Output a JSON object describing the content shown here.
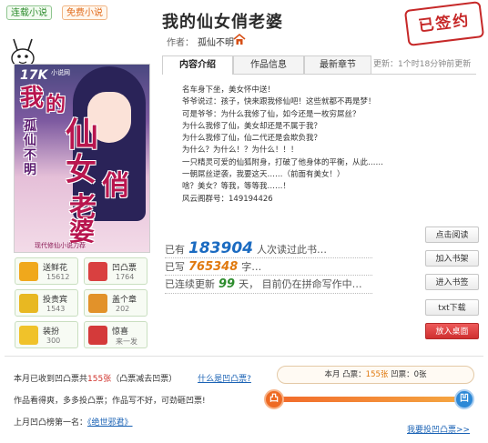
{
  "tags": {
    "serial": "连载小说",
    "free": "免费小说"
  },
  "book": {
    "title": "我的仙女俏老婆",
    "author_label": "作者：",
    "author": "孤仙不明",
    "stamp": "已签约"
  },
  "cover": {
    "brand": "17K",
    "brand_sub": "小说网",
    "title_chars": [
      "我",
      "的",
      "仙",
      "女",
      "俏",
      "老",
      "婆"
    ],
    "author_vertical": "孤仙不明",
    "slogan": "现代修仙小说力荐"
  },
  "tabs": [
    {
      "label": "内容介绍",
      "active": true
    },
    {
      "label": "作品信息",
      "active": false
    },
    {
      "label": "最新章节",
      "active": false
    }
  ],
  "update": {
    "prefix": "更新：",
    "time": "1个时18分钟前更新"
  },
  "intro_lines": [
    "名车身下坐，美女怀中送！",
    "爷爷说过：孩子，快来跟我修仙吧！这些就都不再是梦！",
    "可是爷爷：为什么我修了仙，如今还是一枚穷屌丝？",
    "为什么我修了仙，美女却还是不属于我？",
    "为什么我修了仙，仙二代还是会欺负我？",
    "为什么？为什么！？为什么！！！",
    "一只精灵可爱的仙狐附身，打破了他身体的平衡，从此……",
    "一朝屌丝逆袭，我要这天……（前面有美女！）",
    "啥？美女？等我，等等我……！",
    "风云阁群号：149194426"
  ],
  "stats": {
    "readers_prefix": "已有",
    "readers": "183904",
    "readers_suffix": "人次读过此书…",
    "words_prefix": "已写",
    "words": "765348",
    "words_suffix": "字…",
    "days_prefix": "已连续更新",
    "days": "99",
    "days_suffix": "天， 目前仍在拼命写作中…"
  },
  "actions": [
    "点击阅读",
    "加入书架",
    "进入书签",
    "txt下载",
    "放入桌面"
  ],
  "gifts": [
    {
      "label": "送鲜花",
      "count": "15612",
      "icon": "flower-icon",
      "color": "#f0a81c"
    },
    {
      "label": "凹凸票",
      "count": "1764",
      "icon": "ticket-icon",
      "color": "#d94040"
    },
    {
      "label": "投贵宾",
      "count": "1543",
      "icon": "crown-icon",
      "color": "#e8b822"
    },
    {
      "label": "盖个章",
      "count": "202",
      "icon": "stamp-icon",
      "color": "#e2922a"
    },
    {
      "label": "装扮",
      "count": "300",
      "icon": "dress-icon",
      "color": "#f0c22a"
    },
    {
      "label": "惊喜",
      "count": "来一发",
      "icon": "surprise-icon",
      "color": "#d43a3a"
    }
  ],
  "vote": {
    "received_prefix": "本月已收到凹凸票共",
    "received": "155张",
    "received_suffix": "（凸票减去凹票）",
    "help_link": "什么是凹凸票?",
    "box_prefix": "本月 凸票：",
    "box_up": "155张",
    "box_mid": " 凹票：",
    "box_down": "0张",
    "hint": "作品看得爽，多多投凸票；作品写不好，可劲砸凹票!",
    "last_month_prefix": "上月凹凸榜第一名：",
    "last_month": "《绝世邪君》",
    "vote_link": "我要投凹凸票>>",
    "up_glyph": "凸",
    "down_glyph": "凹"
  },
  "colors": {
    "accent_blue": "#1b6bc1",
    "accent_orange": "#e07a10",
    "stamp_red": "#c62828"
  }
}
